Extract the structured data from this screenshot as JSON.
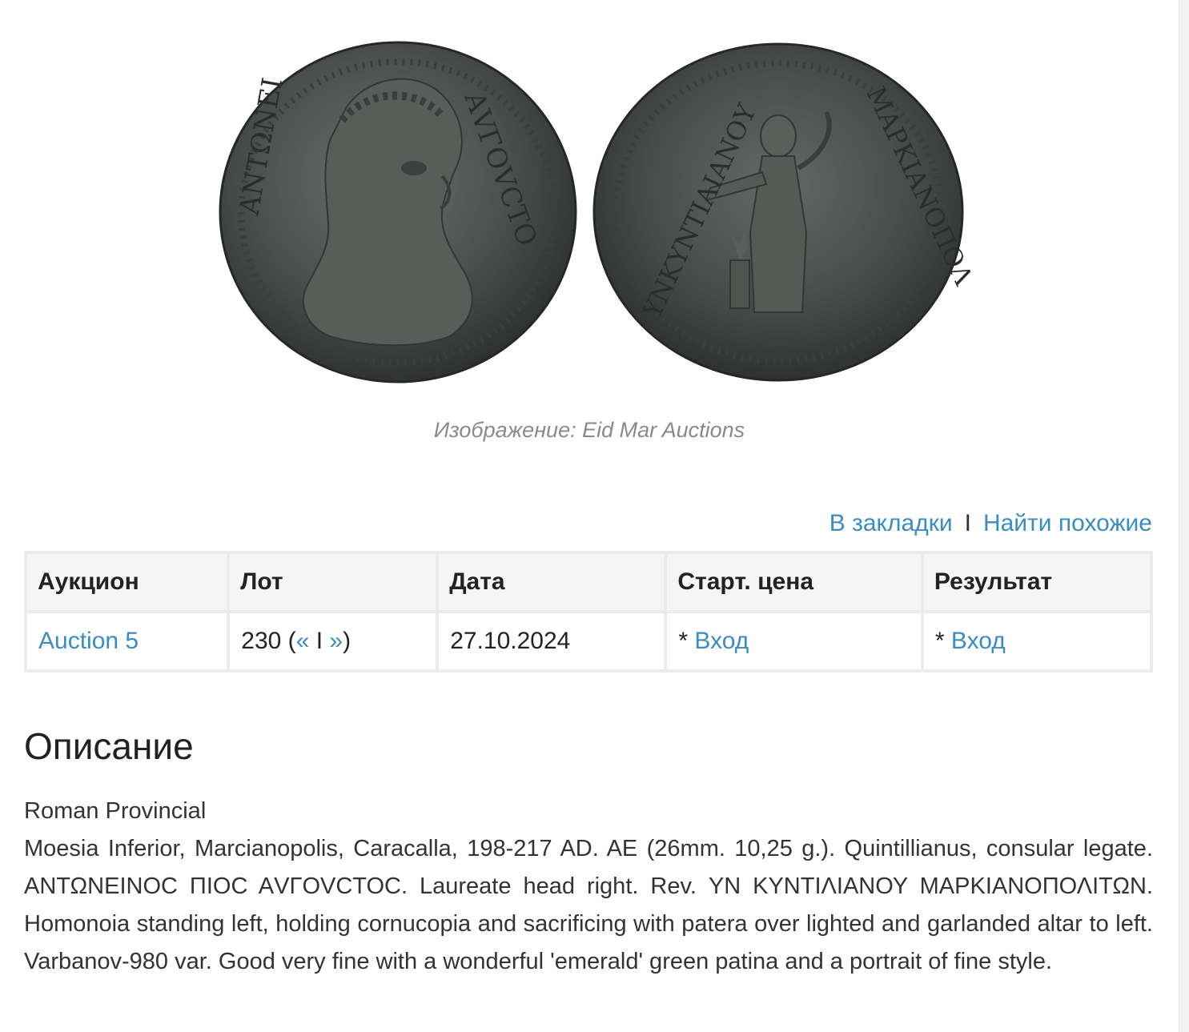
{
  "image_caption": "Изображение: Eid Mar Auctions",
  "actions": {
    "bookmark": "В закладки",
    "separator": "I",
    "find_similar": "Найти похожие"
  },
  "table": {
    "headers": [
      "Аукцион",
      "Лот",
      "Дата",
      "Старт. цена",
      "Результат"
    ],
    "row": {
      "auction": "Auction 5",
      "lot_number": "230 (",
      "lot_prev": "«",
      "lot_sep": " I ",
      "lot_next": "»",
      "lot_close": ")",
      "date": "27.10.2024",
      "start_prefix": "* ",
      "start_link": "Вход",
      "result_prefix": "* ",
      "result_link": "Вход"
    }
  },
  "description": {
    "heading": "Описание",
    "category": "Roman Provincial",
    "text": "Moesia Inferior, Marcianopolis, Caracalla, 198-217 AD. AE (26mm. 10,25 g.). Quintillianus, consular legate. ΑΝΤΩΝΕΙΝΟϹ ΠΙΟϹ ΑVΓΟVϹΤΟϹ. Laureate head right. Rev. ΥΝ ΚΥΝΤΙΛΙΑΝΟΥ ΜΑΡΚΙΑΝΟΠΟΛΙΤΩΝ. Homonoia standing left, holding cornucopia and sacrificing with patera over lighted and garlanded altar to left. Varbanov-980 var. Good very fine with a wonderful 'emerald' green patina and a portrait of fine style."
  },
  "colors": {
    "link": "#3a8dc0",
    "coin": "#4a4e4c"
  }
}
